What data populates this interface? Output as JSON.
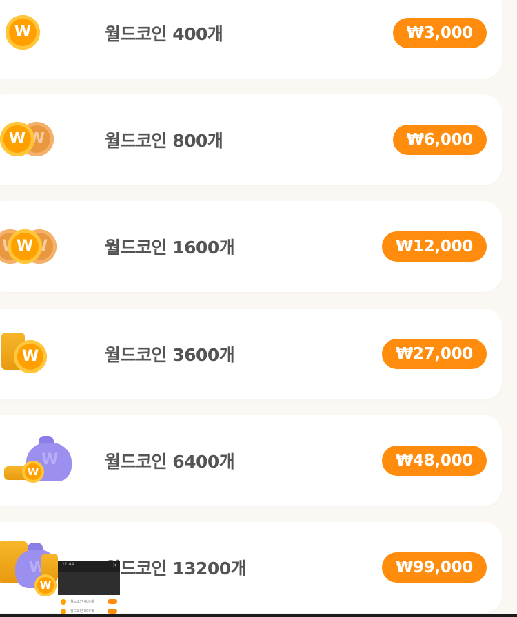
{
  "products": [
    {
      "label": "월드코인 400개",
      "price": "₩3,000",
      "icon": "single-coin-icon"
    },
    {
      "label": "월드코인 800개",
      "price": "₩6,000",
      "icon": "two-coins-icon"
    },
    {
      "label": "월드코인 1600개",
      "price": "₩12,000",
      "icon": "three-coins-icon"
    },
    {
      "label": "월드코인 3600개",
      "price": "₩27,000",
      "icon": "coin-stack-icon"
    },
    {
      "label": "월드코인 6400개",
      "price": "₩48,000",
      "icon": "coin-bag-icon"
    },
    {
      "label": "월드코인 13200개",
      "price": "₩99,000",
      "icon": "coin-treasure-icon"
    }
  ],
  "coin_letter": "W",
  "thumbnail": {
    "time": "11:44",
    "close": "×",
    "rows": [
      "월드코인 400개",
      "월드코인 800개"
    ]
  },
  "colors": {
    "accent": "#ff8c0c",
    "coin": "#ffa000",
    "bag": "#9b8ff0",
    "background": "#fbf8f4"
  }
}
